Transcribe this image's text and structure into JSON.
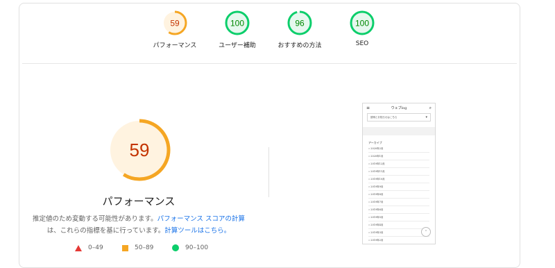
{
  "summary": [
    {
      "score": "59",
      "label": "パフォーマンス",
      "fraction": 0.59,
      "status": "average"
    },
    {
      "score": "100",
      "label": "ユーザー補助",
      "fraction": 1.0,
      "status": "pass"
    },
    {
      "score": "96",
      "label": "おすすめの方法",
      "fraction": 0.96,
      "status": "pass"
    },
    {
      "score": "100",
      "label": "SEO",
      "fraction": 1.0,
      "status": "pass"
    }
  ],
  "main": {
    "score": "59",
    "fraction": 0.59,
    "title": "パフォーマンス",
    "desc_part1": "推定値のため変動する可能性があります。",
    "desc_link1": "パフォーマンス スコアの計算",
    "desc_part2": "は、これらの指標を基に行っています。",
    "desc_link2": "計算ツールはこちら。"
  },
  "legend": [
    {
      "range": "0–49",
      "shape": "triangle",
      "color": "#e53935"
    },
    {
      "range": "50–89",
      "shape": "square",
      "color": "#f5a623"
    },
    {
      "range": "90–100",
      "shape": "circle",
      "color": "#0cce6b"
    }
  ],
  "colors": {
    "average_ring": "#f5a623",
    "average_bg": "#fff3e0",
    "average_text": "#c33300",
    "pass_ring": "#0cce6b",
    "pass_bg": "#e6f8ee",
    "pass_text": "#008800"
  },
  "preview": {
    "site_title": "ウェブlog",
    "select_text": "説明とお知らせはこちら",
    "archive_heading": "アーカイブ",
    "archive_items": [
      "2020年2月",
      "2020年1月",
      "2019年12月",
      "2019年11月",
      "2019年10月",
      "2019年9月",
      "2019年8月",
      "2019年7月",
      "2019年6月",
      "2019年5月",
      "2019年4月",
      "2019年3月",
      "2019年2月",
      "2019年1月",
      "2018年12月"
    ]
  }
}
